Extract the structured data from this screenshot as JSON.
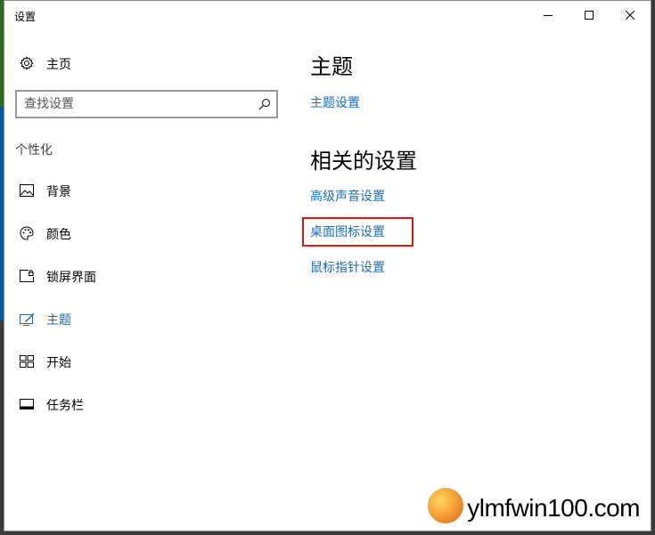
{
  "window": {
    "title": "设置"
  },
  "sidebar": {
    "home_label": "主页",
    "search": {
      "placeholder": "查找设置",
      "value": ""
    },
    "section_label": "个性化",
    "items": [
      {
        "label": "背景",
        "icon": "picture-icon"
      },
      {
        "label": "颜色",
        "icon": "palette-icon"
      },
      {
        "label": "锁屏界面",
        "icon": "lock-screen-icon"
      },
      {
        "label": "主题",
        "icon": "theme-icon",
        "active": true
      },
      {
        "label": "开始",
        "icon": "start-tiles-icon"
      },
      {
        "label": "任务栏",
        "icon": "taskbar-icon"
      }
    ]
  },
  "main": {
    "theme_heading": "主题",
    "theme_settings_link": "主题设置",
    "related_heading": "相关的设置",
    "related_links": [
      "高级声音设置",
      "桌面图标设置",
      "鼠标指针设置"
    ]
  },
  "watermark": {
    "text": "ylmfwin100.com"
  },
  "colors": {
    "accent": "#1a6fb0",
    "highlight_box": "#d9171b"
  }
}
